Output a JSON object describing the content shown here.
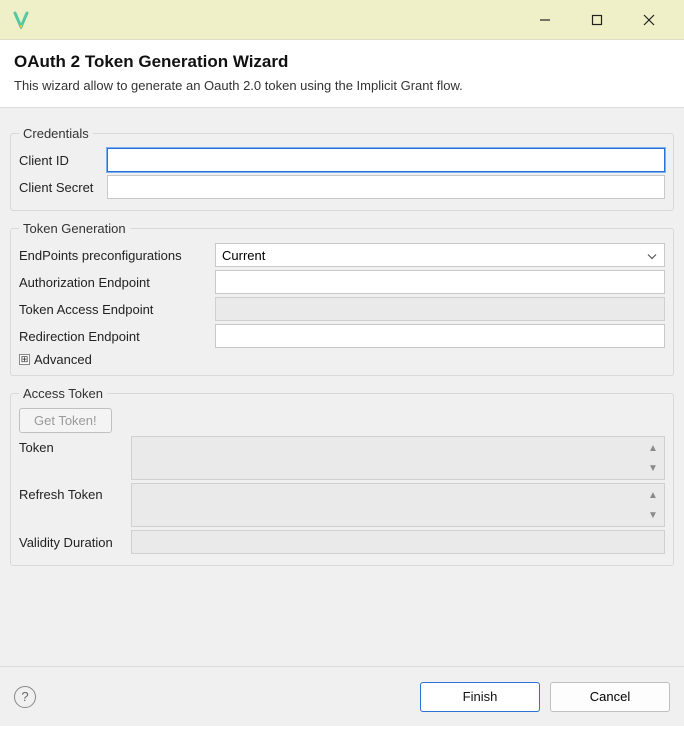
{
  "window": {
    "app_icon_color_top": "#55c9a0",
    "app_icon_color_bottom": "#f2b84a"
  },
  "header": {
    "title": "OAuth 2 Token Generation Wizard",
    "subtitle": "This wizard allow to generate an Oauth 2.0 token using the Implicit Grant flow."
  },
  "credentials": {
    "legend": "Credentials",
    "client_id_label": "Client ID",
    "client_id_value": "",
    "client_secret_label": "Client Secret",
    "client_secret_value": ""
  },
  "token_generation": {
    "legend": "Token Generation",
    "preconfig_label": "EndPoints preconfigurations",
    "preconfig_value": "Current",
    "auth_endpoint_label": "Authorization Endpoint",
    "auth_endpoint_value": "",
    "token_access_label": "Token Access Endpoint",
    "token_access_value": "",
    "redirect_label": "Redirection Endpoint",
    "redirect_value": "",
    "advanced_label": "Advanced"
  },
  "access_token": {
    "legend": "Access Token",
    "get_token_label": "Get Token!",
    "token_label": "Token",
    "token_value": "",
    "refresh_label": "Refresh Token",
    "refresh_value": "",
    "validity_label": "Validity Duration",
    "validity_value": ""
  },
  "footer": {
    "help_tooltip": "Help",
    "finish_label": "Finish",
    "cancel_label": "Cancel"
  }
}
